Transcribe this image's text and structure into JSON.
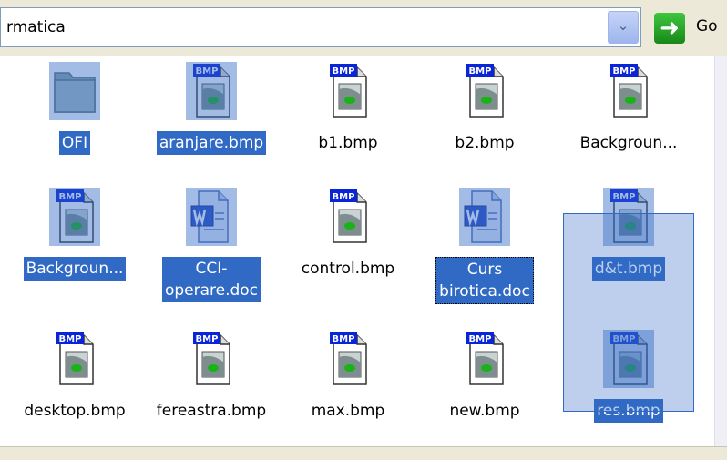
{
  "address_bar": {
    "path": "rmatica",
    "go_label": "Go"
  },
  "items": [
    {
      "name": "OFI",
      "type": "folder",
      "selected": true
    },
    {
      "name": "aranjare.bmp",
      "type": "bmp",
      "selected": true
    },
    {
      "name": "b1.bmp",
      "type": "bmp",
      "selected": false
    },
    {
      "name": "b2.bmp",
      "type": "bmp",
      "selected": false
    },
    {
      "name": "Backgroun...",
      "type": "bmp",
      "selected": false
    },
    {
      "name": "Backgroun...",
      "type": "bmp",
      "selected": true
    },
    {
      "name": "CCI-\noperare.doc",
      "type": "doc",
      "selected": true
    },
    {
      "name": "control.bmp",
      "type": "bmp",
      "selected": false
    },
    {
      "name": "Curs\nbirotica.doc",
      "type": "doc",
      "selected": true,
      "focused": true
    },
    {
      "name": "d&t.bmp",
      "type": "bmp",
      "selected": true
    },
    {
      "name": "desktop.bmp",
      "type": "bmp",
      "selected": false
    },
    {
      "name": "fereastra.bmp",
      "type": "bmp",
      "selected": false
    },
    {
      "name": "max.bmp",
      "type": "bmp",
      "selected": false
    },
    {
      "name": "new.bmp",
      "type": "bmp",
      "selected": false
    },
    {
      "name": "res.bmp",
      "type": "bmp",
      "selected": true
    }
  ],
  "icon_kinds": {
    "folder": "folder-icon",
    "bmp": "bmp-file-icon",
    "doc": "word-document-icon"
  },
  "colors": {
    "selection": "#316ac5",
    "bmp_badge": "#0a24d8",
    "word_blue": "#2b4dc4"
  }
}
